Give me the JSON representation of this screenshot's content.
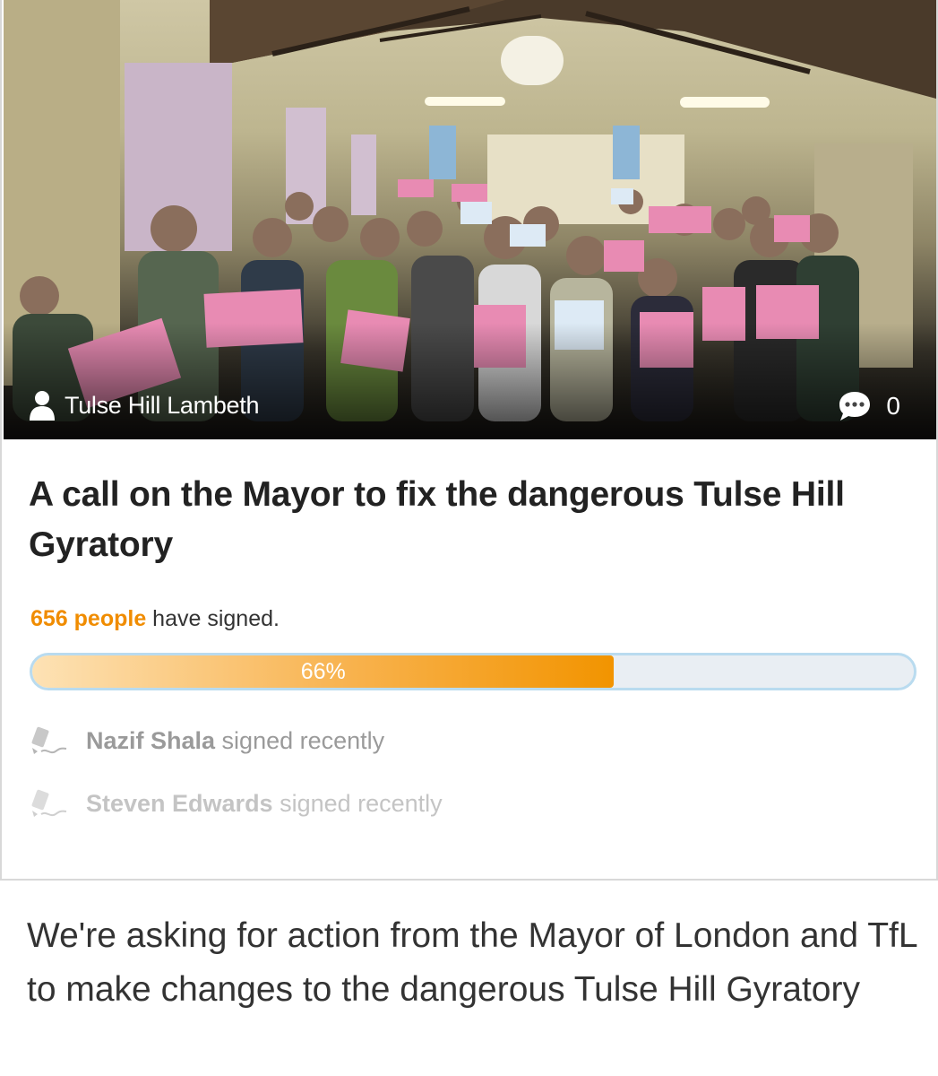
{
  "petition": {
    "author": "Tulse Hill Lambeth",
    "comment_count": "0",
    "title": "A call on the Mayor to fix the dangerous Tulse Hill Gyratory",
    "signed_count": "656 people",
    "signed_suffix": " have signed.",
    "progress_percent": 66,
    "progress_label": "66%",
    "recent_signers": [
      {
        "name": "Nazif Shala",
        "status": " signed recently"
      },
      {
        "name": "Steven Edwards",
        "status": " signed recently"
      }
    ],
    "description": "We're asking for action from the Mayor of London and TfL to make changes to the dangerous Tulse Hill Gyratory"
  },
  "colors": {
    "accent": "#f29400",
    "progress_track": "#e9eef3",
    "progress_border": "#b9dbef"
  },
  "icons": {
    "author": "user-icon",
    "comments": "speech-bubble-icon",
    "signer": "pen-signature-icon"
  }
}
